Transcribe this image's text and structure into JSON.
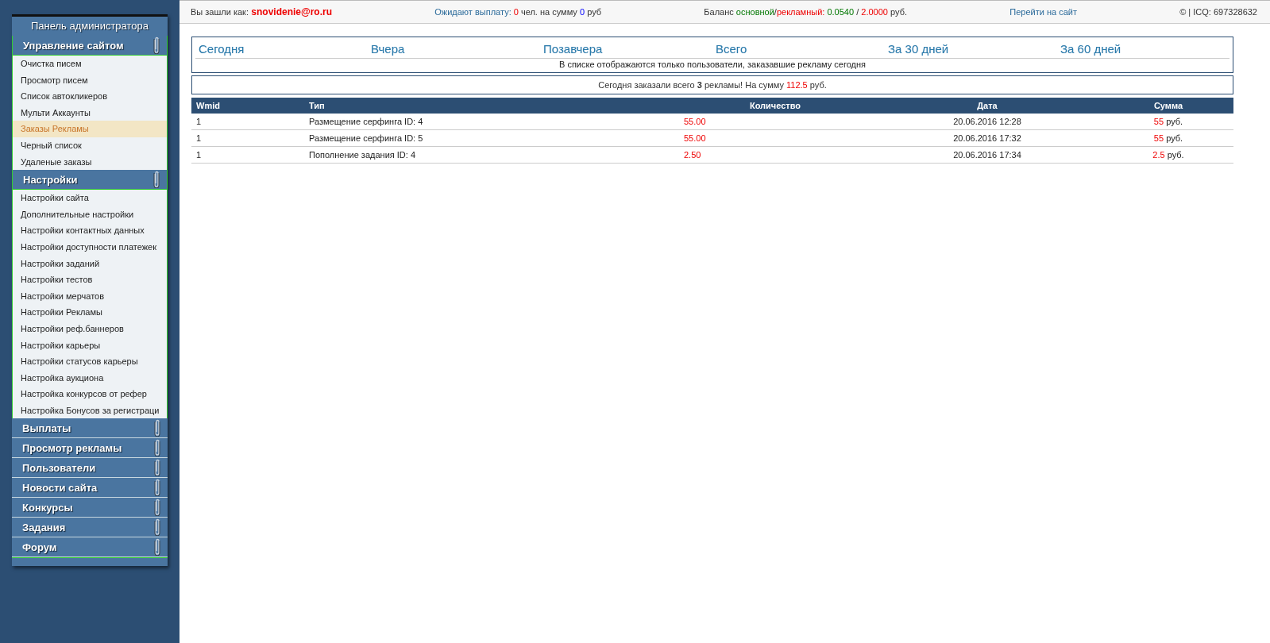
{
  "sidebar": {
    "title": "Панель администратора",
    "sections": [
      {
        "label": "Управление сайтом",
        "expanded": true,
        "items": [
          {
            "label": "Очистка писем",
            "selected": false
          },
          {
            "label": "Просмотр писем",
            "selected": false
          },
          {
            "label": "Список автокликеров",
            "selected": false
          },
          {
            "label": "Мульти Аккаунты",
            "selected": false
          },
          {
            "label": "Заказы Рекламы",
            "selected": true
          },
          {
            "label": "Черный список",
            "selected": false
          },
          {
            "label": "Удаленые заказы",
            "selected": false
          }
        ]
      },
      {
        "label": "Настройки",
        "expanded": true,
        "items": [
          {
            "label": "Настройки сайта",
            "selected": false
          },
          {
            "label": "Дополнительные настройки",
            "selected": false
          },
          {
            "label": "Настройки контактных данных",
            "selected": false
          },
          {
            "label": "Настройки доступности платежек",
            "selected": false
          },
          {
            "label": "Настройки заданий",
            "selected": false
          },
          {
            "label": "Настройки тестов",
            "selected": false
          },
          {
            "label": "Настройки мерчатов",
            "selected": false
          },
          {
            "label": "Настройки Рекламы",
            "selected": false
          },
          {
            "label": "Настройки реф.баннеров",
            "selected": false
          },
          {
            "label": "Настройки карьеры",
            "selected": false
          },
          {
            "label": "Настройки статусов карьеры",
            "selected": false
          },
          {
            "label": "Настройка аукциона",
            "selected": false
          },
          {
            "label": "Настройка конкурсов от рефер",
            "selected": false
          },
          {
            "label": "Настройка Бонусов за регистраци",
            "selected": false
          }
        ]
      },
      {
        "label": "Выплаты",
        "expanded": false
      },
      {
        "label": "Просмотр рекламы",
        "expanded": false
      },
      {
        "label": "Пользователи",
        "expanded": false
      },
      {
        "label": "Новости сайта",
        "expanded": false
      },
      {
        "label": "Конкурсы",
        "expanded": false
      },
      {
        "label": "Задания",
        "expanded": false
      },
      {
        "label": "Форум",
        "expanded": false
      }
    ]
  },
  "top_bar": [
    {
      "parts": [
        {
          "kind": "plain",
          "text": "Вы зашли как:"
        },
        {
          "kind": "user",
          "text": "snovidenie@ro.ru"
        }
      ]
    },
    {
      "parts": [
        {
          "kind": "link",
          "text": "Ожидают выплату:"
        },
        {
          "kind": "red",
          "text": "0"
        },
        {
          "kind": "plain",
          "text": "чел. на сумму"
        },
        {
          "kind": "blue",
          "text": "0"
        },
        {
          "kind": "plain",
          "text": "руб"
        }
      ]
    },
    {
      "parts": [
        {
          "kind": "plain",
          "text": "Баланс"
        },
        {
          "kind": "green",
          "text": "основной"
        },
        {
          "kind": "plain",
          "text": "/",
          "join": true
        },
        {
          "kind": "red",
          "text": "рекламный:",
          "join": true
        },
        {
          "kind": "green",
          "text": "0.0540"
        },
        {
          "kind": "plain",
          "text": "/"
        },
        {
          "kind": "red",
          "text": "2.0000"
        },
        {
          "kind": "plain",
          "text": "руб."
        }
      ]
    },
    {
      "parts": [
        {
          "kind": "link",
          "text": "Перейти на сайт"
        }
      ]
    },
    {
      "parts": [
        {
          "kind": "plain",
          "text": "© | ICQ: 697328632"
        }
      ]
    }
  ],
  "periods": [
    "Сегодня",
    "Вчера",
    "Позавчера",
    "Всего",
    "За 30 дней",
    "За 60 дней"
  ],
  "period_note": "В списке отображаются только пользователи, заказавшие рекламу сегодня",
  "summary": [
    {
      "kind": "plain",
      "text": "Сегодня заказали всего **3** рекламы! На сумму"
    },
    {
      "kind": "red",
      "text": "112.5"
    },
    {
      "kind": "plain",
      "text": "руб."
    }
  ],
  "table": {
    "columns": [
      "Wmid",
      "Тип",
      "Количество",
      "Дата",
      "Сумма"
    ],
    "rows": [
      {
        "wmid": "1",
        "type": "Размещение серфинга ID: 4",
        "quantity": "55.00",
        "date": "20.06.2016 12:28",
        "amount": "55",
        "currency": "руб."
      },
      {
        "wmid": "1",
        "type": "Размещение серфинга ID: 5",
        "quantity": "55.00",
        "date": "20.06.2016 17:32",
        "amount": "55",
        "currency": "руб."
      },
      {
        "wmid": "1",
        "type": "Пополнение задания ID: 4",
        "quantity": "2.50",
        "date": "20.06.2016 17:34",
        "amount": "2.5",
        "currency": "руб."
      }
    ]
  }
}
